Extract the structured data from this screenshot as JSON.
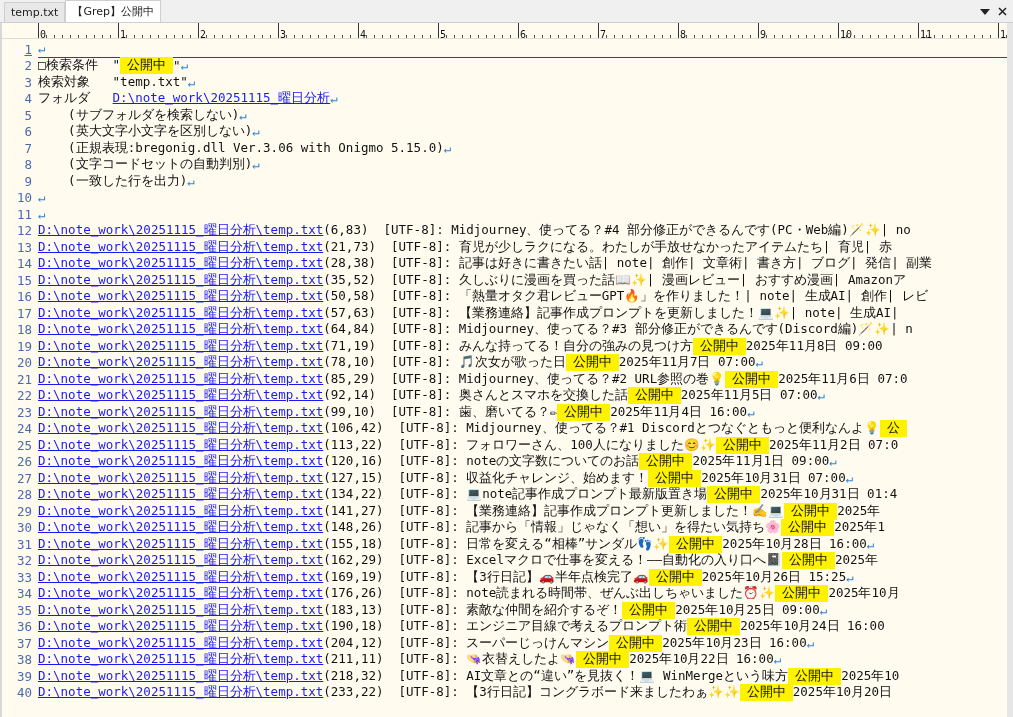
{
  "tabs": [
    {
      "label": "temp.txt",
      "selected": false
    },
    {
      "label": "【Grep】公開中",
      "selected": true
    }
  ],
  "ruler": {
    "labels": [
      "0",
      "1",
      "2",
      "3",
      "4",
      "5",
      "6",
      "7",
      "8",
      "9",
      "10",
      "11",
      "1"
    ]
  },
  "lines": [
    {
      "number": "1",
      "current": true,
      "segments": [
        {
          "kind": "eol",
          "text": "↵"
        }
      ]
    },
    {
      "number": "2",
      "current": false,
      "segments": [
        {
          "kind": "text",
          "text": "□検索条件  \""
        },
        {
          "kind": "match",
          "text": "公開中"
        },
        {
          "kind": "text",
          "text": "\""
        },
        {
          "kind": "eol",
          "text": "↵"
        }
      ]
    },
    {
      "number": "3",
      "current": false,
      "segments": [
        {
          "kind": "text",
          "text": "検索対象   \"temp.txt\""
        },
        {
          "kind": "eol",
          "text": "↵"
        }
      ]
    },
    {
      "number": "4",
      "current": false,
      "segments": [
        {
          "kind": "text",
          "text": "フォルダ   "
        },
        {
          "kind": "link",
          "text": "D:\\note_work\\20251115_曜日分析"
        },
        {
          "kind": "eol",
          "text": "↵"
        }
      ]
    },
    {
      "number": "5",
      "current": false,
      "segments": [
        {
          "kind": "text",
          "text": "    (サブフォルダを検索しない)"
        },
        {
          "kind": "eol",
          "text": "↵"
        }
      ]
    },
    {
      "number": "6",
      "current": false,
      "segments": [
        {
          "kind": "text",
          "text": "    (英大文字小文字を区別しない)"
        },
        {
          "kind": "eol",
          "text": "↵"
        }
      ]
    },
    {
      "number": "7",
      "current": false,
      "segments": [
        {
          "kind": "text",
          "text": "    (正規表現:bregonig.dll Ver.3.06 with Onigmo 5.15.0)"
        },
        {
          "kind": "eol",
          "text": "↵"
        }
      ]
    },
    {
      "number": "8",
      "current": false,
      "segments": [
        {
          "kind": "text",
          "text": "    (文字コードセットの自動判別)"
        },
        {
          "kind": "eol",
          "text": "↵"
        }
      ]
    },
    {
      "number": "9",
      "current": false,
      "segments": [
        {
          "kind": "text",
          "text": "    (一致した行を出力)"
        },
        {
          "kind": "eol",
          "text": "↵"
        }
      ]
    },
    {
      "number": "10",
      "current": false,
      "segments": [
        {
          "kind": "eol",
          "text": "↵"
        }
      ]
    },
    {
      "number": "11",
      "current": false,
      "segments": [
        {
          "kind": "eol",
          "text": "↵"
        }
      ]
    },
    {
      "number": "12",
      "current": false,
      "segments": [
        {
          "kind": "link",
          "text": "D:\\note_work\\20251115_曜日分析\\temp.txt"
        },
        {
          "kind": "text",
          "text": "(6,83)  [UTF-8]: Midjourney、使ってる？#4 部分修正ができるんです(PC・Web編)🪄✨| no"
        }
      ]
    },
    {
      "number": "13",
      "current": false,
      "segments": [
        {
          "kind": "link",
          "text": "D:\\note_work\\20251115_曜日分析\\temp.txt"
        },
        {
          "kind": "text",
          "text": "(21,73)  [UTF-8]: 育児が少しラクになる。わたしが手放せなかったアイテムたち| 育児| 赤"
        }
      ]
    },
    {
      "number": "14",
      "current": false,
      "segments": [
        {
          "kind": "link",
          "text": "D:\\note_work\\20251115_曜日分析\\temp.txt"
        },
        {
          "kind": "text",
          "text": "(28,38)  [UTF-8]: 記事は好きに書きたい話| note| 創作| 文章術| 書き方| ブログ| 発信| 副業"
        }
      ]
    },
    {
      "number": "15",
      "current": false,
      "segments": [
        {
          "kind": "link",
          "text": "D:\\note_work\\20251115_曜日分析\\temp.txt"
        },
        {
          "kind": "text",
          "text": "(35,52)  [UTF-8]: 久しぶりに漫画を買った話📖✨| 漫画レビュー| おすすめ漫画| Amazonア"
        }
      ]
    },
    {
      "number": "16",
      "current": false,
      "segments": [
        {
          "kind": "link",
          "text": "D:\\note_work\\20251115_曜日分析\\temp.txt"
        },
        {
          "kind": "text",
          "text": "(50,58)  [UTF-8]: 「熱量オタク君レビューGPT🔥」を作りました！| note| 生成AI| 創作| レビ"
        }
      ]
    },
    {
      "number": "17",
      "current": false,
      "segments": [
        {
          "kind": "link",
          "text": "D:\\note_work\\20251115_曜日分析\\temp.txt"
        },
        {
          "kind": "text",
          "text": "(57,63)  [UTF-8]: 【業務連絡】記事作成プロンプトを更新しました！💻✨| note| 生成AI|"
        }
      ]
    },
    {
      "number": "18",
      "current": false,
      "segments": [
        {
          "kind": "link",
          "text": "D:\\note_work\\20251115_曜日分析\\temp.txt"
        },
        {
          "kind": "text",
          "text": "(64,84)  [UTF-8]: Midjourney、使ってる？#3 部分修正ができるんです(Discord編)🪄✨| n"
        }
      ]
    },
    {
      "number": "19",
      "current": false,
      "segments": [
        {
          "kind": "link",
          "text": "D:\\note_work\\20251115_曜日分析\\temp.txt"
        },
        {
          "kind": "text",
          "text": "(71,19)  [UTF-8]: みんな持ってる！自分の強みの見つけ方"
        },
        {
          "kind": "match",
          "text": "公開中"
        },
        {
          "kind": "text",
          "text": "2025年11月8日 09:00"
        }
      ]
    },
    {
      "number": "20",
      "current": false,
      "segments": [
        {
          "kind": "link",
          "text": "D:\\note_work\\20251115_曜日分析\\temp.txt"
        },
        {
          "kind": "text",
          "text": "(78,10)  [UTF-8]: 🎵次女が歌った日"
        },
        {
          "kind": "match",
          "text": "公開中"
        },
        {
          "kind": "text",
          "text": "2025年11月7日 07:00"
        },
        {
          "kind": "eol",
          "text": "↵"
        }
      ]
    },
    {
      "number": "21",
      "current": false,
      "segments": [
        {
          "kind": "link",
          "text": "D:\\note_work\\20251115_曜日分析\\temp.txt"
        },
        {
          "kind": "text",
          "text": "(85,29)  [UTF-8]: Midjourney、使ってる？#2 URL参照の巻💡"
        },
        {
          "kind": "match",
          "text": "公開中"
        },
        {
          "kind": "text",
          "text": "2025年11月6日 07:0"
        }
      ]
    },
    {
      "number": "22",
      "current": false,
      "segments": [
        {
          "kind": "link",
          "text": "D:\\note_work\\20251115_曜日分析\\temp.txt"
        },
        {
          "kind": "text",
          "text": "(92,14)  [UTF-8]: 奥さんとスマホを交換した話"
        },
        {
          "kind": "match",
          "text": "公開中"
        },
        {
          "kind": "text",
          "text": "2025年11月5日 07:00"
        },
        {
          "kind": "eol",
          "text": "↵"
        }
      ]
    },
    {
      "number": "23",
      "current": false,
      "segments": [
        {
          "kind": "link",
          "text": "D:\\note_work\\20251115_曜日分析\\temp.txt"
        },
        {
          "kind": "text",
          "text": "(99,10)  [UTF-8]: 歯、磨いてる？✏"
        },
        {
          "kind": "match",
          "text": "公開中"
        },
        {
          "kind": "text",
          "text": "2025年11月4日 16:00"
        },
        {
          "kind": "eol",
          "text": "↵"
        }
      ]
    },
    {
      "number": "24",
      "current": false,
      "segments": [
        {
          "kind": "link",
          "text": "D:\\note_work\\20251115_曜日分析\\temp.txt"
        },
        {
          "kind": "text",
          "text": "(106,42)  [UTF-8]: Midjourney、使ってる？#1 Discordとつなぐともっと便利なんよ💡"
        },
        {
          "kind": "match",
          "text": "公"
        }
      ]
    },
    {
      "number": "25",
      "current": false,
      "segments": [
        {
          "kind": "link",
          "text": "D:\\note_work\\20251115_曜日分析\\temp.txt"
        },
        {
          "kind": "text",
          "text": "(113,22)  [UTF-8]: フォロワーさん、100人になりました😊✨"
        },
        {
          "kind": "match",
          "text": "公開中"
        },
        {
          "kind": "text",
          "text": "2025年11月2日 07:0"
        }
      ]
    },
    {
      "number": "26",
      "current": false,
      "segments": [
        {
          "kind": "link",
          "text": "D:\\note_work\\20251115_曜日分析\\temp.txt"
        },
        {
          "kind": "text",
          "text": "(120,16)  [UTF-8]: noteの文字数についてのお話"
        },
        {
          "kind": "match",
          "text": "公開中"
        },
        {
          "kind": "text",
          "text": "2025年11月1日 09:00"
        },
        {
          "kind": "eol",
          "text": "↵"
        }
      ]
    },
    {
      "number": "27",
      "current": false,
      "segments": [
        {
          "kind": "link",
          "text": "D:\\note_work\\20251115_曜日分析\\temp.txt"
        },
        {
          "kind": "text",
          "text": "(127,15)  [UTF-8]: 収益化チャレンジ、始めます！"
        },
        {
          "kind": "match",
          "text": "公開中"
        },
        {
          "kind": "text",
          "text": "2025年10月31日 07:00"
        },
        {
          "kind": "eol",
          "text": "↵"
        }
      ]
    },
    {
      "number": "28",
      "current": false,
      "segments": [
        {
          "kind": "link",
          "text": "D:\\note_work\\20251115_曜日分析\\temp.txt"
        },
        {
          "kind": "text",
          "text": "(134,22)  [UTF-8]: 💻note記事作成プロンプト最新版置き場"
        },
        {
          "kind": "match",
          "text": "公開中"
        },
        {
          "kind": "text",
          "text": "2025年10月31日 01:4"
        }
      ]
    },
    {
      "number": "29",
      "current": false,
      "segments": [
        {
          "kind": "link",
          "text": "D:\\note_work\\20251115_曜日分析\\temp.txt"
        },
        {
          "kind": "text",
          "text": "(141,27)  [UTF-8]: 【業務連絡】記事作成プロンプト更新しました！✍️💻"
        },
        {
          "kind": "match",
          "text": "公開中"
        },
        {
          "kind": "text",
          "text": "2025年"
        }
      ]
    },
    {
      "number": "30",
      "current": false,
      "segments": [
        {
          "kind": "link",
          "text": "D:\\note_work\\20251115_曜日分析\\temp.txt"
        },
        {
          "kind": "text",
          "text": "(148,26)  [UTF-8]: 記事から「情報」じゃなく「想い」を得たい気持ち🌸"
        },
        {
          "kind": "match",
          "text": "公開中"
        },
        {
          "kind": "text",
          "text": "2025年1"
        }
      ]
    },
    {
      "number": "31",
      "current": false,
      "segments": [
        {
          "kind": "link",
          "text": "D:\\note_work\\20251115_曜日分析\\temp.txt"
        },
        {
          "kind": "text",
          "text": "(155,18)  [UTF-8]: 日常を変える“相棒”サンダル👣✨"
        },
        {
          "kind": "match",
          "text": "公開中"
        },
        {
          "kind": "text",
          "text": "2025年10月28日 16:00"
        },
        {
          "kind": "eol",
          "text": "↵"
        }
      ]
    },
    {
      "number": "32",
      "current": false,
      "segments": [
        {
          "kind": "link",
          "text": "D:\\note_work\\20251115_曜日分析\\temp.txt"
        },
        {
          "kind": "text",
          "text": "(162,29)  [UTF-8]: Excelマクロで仕事を変える！——自動化の入り口へ📓"
        },
        {
          "kind": "match",
          "text": "公開中"
        },
        {
          "kind": "text",
          "text": "2025年"
        }
      ]
    },
    {
      "number": "33",
      "current": false,
      "segments": [
        {
          "kind": "link",
          "text": "D:\\note_work\\20251115_曜日分析\\temp.txt"
        },
        {
          "kind": "text",
          "text": "(169,19)  [UTF-8]: 【3行日記】🚗️半年点検完了🚗️"
        },
        {
          "kind": "match",
          "text": "公開中"
        },
        {
          "kind": "text",
          "text": "2025年10月26日 15:25"
        },
        {
          "kind": "eol",
          "text": "↵"
        }
      ]
    },
    {
      "number": "34",
      "current": false,
      "segments": [
        {
          "kind": "link",
          "text": "D:\\note_work\\20251115_曜日分析\\temp.txt"
        },
        {
          "kind": "text",
          "text": "(176,26)  [UTF-8]: note読まれる時間帯、ぜんぶ出しちゃいました⏰✨"
        },
        {
          "kind": "match",
          "text": "公開中"
        },
        {
          "kind": "text",
          "text": "2025年10月"
        }
      ]
    },
    {
      "number": "35",
      "current": false,
      "segments": [
        {
          "kind": "link",
          "text": "D:\\note_work\\20251115_曜日分析\\temp.txt"
        },
        {
          "kind": "text",
          "text": "(183,13)  [UTF-8]: 素敵な仲間を紹介するぞ！"
        },
        {
          "kind": "match",
          "text": "公開中"
        },
        {
          "kind": "text",
          "text": "2025年10月25日 09:00"
        },
        {
          "kind": "eol",
          "text": "↵"
        }
      ]
    },
    {
      "number": "36",
      "current": false,
      "segments": [
        {
          "kind": "link",
          "text": "D:\\note_work\\20251115_曜日分析\\temp.txt"
        },
        {
          "kind": "text",
          "text": "(190,18)  [UTF-8]: エンジニア目線で考えるプロンプト術"
        },
        {
          "kind": "match",
          "text": "公開中"
        },
        {
          "kind": "text",
          "text": "2025年10月24日 16:00"
        }
      ]
    },
    {
      "number": "37",
      "current": false,
      "segments": [
        {
          "kind": "link",
          "text": "D:\\note_work\\20251115_曜日分析\\temp.txt"
        },
        {
          "kind": "text",
          "text": "(204,12)  [UTF-8]: スーパーじっけんマシン"
        },
        {
          "kind": "match",
          "text": "公開中"
        },
        {
          "kind": "text",
          "text": "2025年10月23日 16:00"
        },
        {
          "kind": "eol",
          "text": "↵"
        }
      ]
    },
    {
      "number": "38",
      "current": false,
      "segments": [
        {
          "kind": "link",
          "text": "D:\\note_work\\20251115_曜日分析\\temp.txt"
        },
        {
          "kind": "text",
          "text": "(211,11)  [UTF-8]: 👒衣替えしたよ👒"
        },
        {
          "kind": "match",
          "text": "公開中"
        },
        {
          "kind": "text",
          "text": "2025年10月22日 16:00"
        },
        {
          "kind": "eol",
          "text": "↵"
        }
      ]
    },
    {
      "number": "39",
      "current": false,
      "segments": [
        {
          "kind": "link",
          "text": "D:\\note_work\\20251115_曜日分析\\temp.txt"
        },
        {
          "kind": "text",
          "text": "(218,32)  [UTF-8]: AI文章との“違い”を見抜く！💻 WinMergeという味方"
        },
        {
          "kind": "match",
          "text": "公開中"
        },
        {
          "kind": "text",
          "text": "2025年10"
        }
      ]
    },
    {
      "number": "40",
      "current": false,
      "segments": [
        {
          "kind": "link",
          "text": "D:\\note_work\\20251115_曜日分析\\temp.txt"
        },
        {
          "kind": "text",
          "text": "(233,22)  [UTF-8]: 【3行日記】コングラボード来ましたわぁ✨✨"
        },
        {
          "kind": "match",
          "text": "公開中"
        },
        {
          "kind": "text",
          "text": "2025年10月20日"
        }
      ]
    }
  ]
}
